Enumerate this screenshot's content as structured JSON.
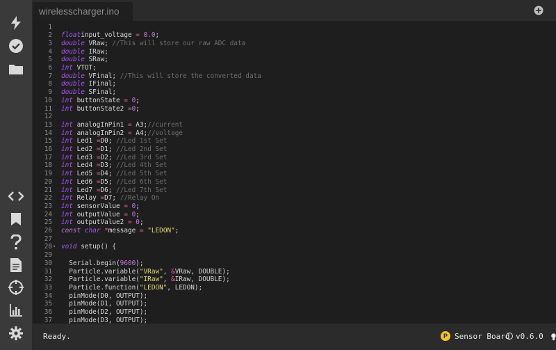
{
  "tab": {
    "title": "wirelesscharger.ino"
  },
  "sidebar": {
    "items": [
      {
        "icon": "flash-icon"
      },
      {
        "icon": "verify-check-icon"
      },
      {
        "icon": "folder-icon"
      },
      {
        "icon": "code-icon"
      },
      {
        "icon": "bookmark-icon"
      },
      {
        "icon": "help-icon"
      },
      {
        "icon": "document-icon"
      },
      {
        "icon": "target-icon"
      },
      {
        "icon": "chart-icon"
      },
      {
        "icon": "gear-icon"
      }
    ]
  },
  "editor": {
    "lines": [
      {
        "n": "1",
        "t": []
      },
      {
        "n": "2",
        "t": [
          [
            "ty",
            "float"
          ],
          [
            "",
            "input_voltage "
          ],
          [
            "op",
            "="
          ],
          [
            "",
            " "
          ],
          [
            "num",
            "0.0"
          ],
          [
            "",
            ";"
          ]
        ]
      },
      {
        "n": "3",
        "t": [
          [
            "ty",
            "double"
          ],
          [
            "",
            " VRaw; "
          ],
          [
            "cm",
            "//This will store our raw ADC data"
          ]
        ]
      },
      {
        "n": "4",
        "t": [
          [
            "ty",
            "double"
          ],
          [
            "",
            " IRaw;"
          ]
        ]
      },
      {
        "n": "5",
        "t": [
          [
            "ty",
            "double"
          ],
          [
            "",
            " SRaw;"
          ]
        ]
      },
      {
        "n": "6",
        "t": [
          [
            "ty",
            "int"
          ],
          [
            "",
            " VTOT;"
          ]
        ]
      },
      {
        "n": "7",
        "t": [
          [
            "ty",
            "double"
          ],
          [
            "",
            " VFinal; "
          ],
          [
            "cm",
            "//This will store the converted data"
          ]
        ]
      },
      {
        "n": "8",
        "t": [
          [
            "ty",
            "double"
          ],
          [
            "",
            " IFinal;"
          ]
        ]
      },
      {
        "n": "9",
        "t": [
          [
            "ty",
            "double"
          ],
          [
            "",
            " SFinal;"
          ]
        ]
      },
      {
        "n": "10",
        "t": [
          [
            "ty",
            "int"
          ],
          [
            "",
            " buttonState "
          ],
          [
            "op",
            "="
          ],
          [
            "",
            " "
          ],
          [
            "num",
            "0"
          ],
          [
            "",
            ";"
          ]
        ]
      },
      {
        "n": "11",
        "t": [
          [
            "ty",
            "int"
          ],
          [
            "",
            " buttonState2 "
          ],
          [
            "op",
            "="
          ],
          [
            "num",
            "0"
          ],
          [
            "",
            ";"
          ]
        ]
      },
      {
        "n": "12",
        "t": []
      },
      {
        "n": "13",
        "t": [
          [
            "ty",
            "int"
          ],
          [
            "",
            " analogInPin1 "
          ],
          [
            "op",
            "="
          ],
          [
            "",
            " A3;"
          ],
          [
            "cm",
            "//current"
          ]
        ]
      },
      {
        "n": "14",
        "t": [
          [
            "ty",
            "int"
          ],
          [
            "",
            " analogInPin2 "
          ],
          [
            "op",
            "="
          ],
          [
            "",
            " A4;"
          ],
          [
            "cm",
            "//voltage"
          ]
        ]
      },
      {
        "n": "15",
        "t": [
          [
            "ty",
            "int"
          ],
          [
            "",
            " Led1 "
          ],
          [
            "op",
            "="
          ],
          [
            "",
            "D0; "
          ],
          [
            "cm",
            "//Led 1st Set"
          ]
        ]
      },
      {
        "n": "16",
        "t": [
          [
            "ty",
            "int"
          ],
          [
            "",
            " Led2 "
          ],
          [
            "op",
            "="
          ],
          [
            "",
            "D1; "
          ],
          [
            "cm",
            "//Led 2nd Set"
          ]
        ]
      },
      {
        "n": "17",
        "t": [
          [
            "ty",
            "int"
          ],
          [
            "",
            " Led3 "
          ],
          [
            "op",
            "="
          ],
          [
            "",
            "D2; "
          ],
          [
            "cm",
            "//Led 3rd Set"
          ]
        ]
      },
      {
        "n": "18",
        "t": [
          [
            "ty",
            "int"
          ],
          [
            "",
            " Led4 "
          ],
          [
            "op",
            "="
          ],
          [
            "",
            "D3; "
          ],
          [
            "cm",
            "//Led 4th Set"
          ]
        ]
      },
      {
        "n": "19",
        "t": [
          [
            "ty",
            "int"
          ],
          [
            "",
            " Led5 "
          ],
          [
            "op",
            "="
          ],
          [
            "",
            "D4; "
          ],
          [
            "cm",
            "//Led 5th Set"
          ]
        ]
      },
      {
        "n": "20",
        "t": [
          [
            "ty",
            "int"
          ],
          [
            "",
            " Led6 "
          ],
          [
            "op",
            "="
          ],
          [
            "",
            "D5; "
          ],
          [
            "cm",
            "//Led 6th Set"
          ]
        ]
      },
      {
        "n": "21",
        "t": [
          [
            "ty",
            "int"
          ],
          [
            "",
            " Led7 "
          ],
          [
            "op",
            "="
          ],
          [
            "",
            "D6; "
          ],
          [
            "cm",
            "//Led 7th Set"
          ]
        ]
      },
      {
        "n": "22",
        "t": [
          [
            "ty",
            "int"
          ],
          [
            "",
            " Relay "
          ],
          [
            "op",
            "="
          ],
          [
            "",
            "D7; "
          ],
          [
            "cm",
            "//Relay On"
          ]
        ]
      },
      {
        "n": "23",
        "t": [
          [
            "ty",
            "int"
          ],
          [
            "",
            " sensorValue "
          ],
          [
            "op",
            "="
          ],
          [
            "",
            " "
          ],
          [
            "num",
            "0"
          ],
          [
            "",
            ";"
          ]
        ]
      },
      {
        "n": "24",
        "t": [
          [
            "ty",
            "int"
          ],
          [
            "",
            " outputValue "
          ],
          [
            "op",
            "="
          ],
          [
            "",
            " "
          ],
          [
            "num",
            "0"
          ],
          [
            "",
            ";"
          ]
        ]
      },
      {
        "n": "25",
        "t": [
          [
            "ty",
            "int"
          ],
          [
            "",
            " outputValue2 "
          ],
          [
            "op",
            "="
          ],
          [
            "",
            " "
          ],
          [
            "num",
            "0"
          ],
          [
            "",
            ";"
          ]
        ]
      },
      {
        "n": "26",
        "t": [
          [
            "kw",
            "const"
          ],
          [
            "",
            " "
          ],
          [
            "ty",
            "char"
          ],
          [
            "",
            " "
          ],
          [
            "op",
            "*"
          ],
          [
            "",
            "message "
          ],
          [
            "op",
            "="
          ],
          [
            "",
            " "
          ],
          [
            "str",
            "\"LEDON\""
          ],
          [
            "",
            ";"
          ]
        ]
      },
      {
        "n": "27",
        "t": []
      },
      {
        "n": "28",
        "fold": true,
        "t": [
          [
            "ty",
            "void"
          ],
          [
            "",
            " setup() {"
          ]
        ]
      },
      {
        "n": "29",
        "t": []
      },
      {
        "n": "30",
        "t": [
          [
            "",
            "  Serial.begin("
          ],
          [
            "num",
            "9600"
          ],
          [
            "",
            ");"
          ]
        ]
      },
      {
        "n": "31",
        "t": [
          [
            "",
            "  Particle.variable("
          ],
          [
            "str",
            "\"VRaw\""
          ],
          [
            "",
            ", "
          ],
          [
            "op",
            "&"
          ],
          [
            "",
            "VRaw, DOUBLE);"
          ]
        ]
      },
      {
        "n": "32",
        "t": [
          [
            "",
            "  Particle.variable("
          ],
          [
            "str",
            "\"IRaw\""
          ],
          [
            "",
            ", "
          ],
          [
            "op",
            "&"
          ],
          [
            "",
            "IRaw, DOUBLE);"
          ]
        ]
      },
      {
        "n": "33",
        "t": [
          [
            "",
            "  Particle.function("
          ],
          [
            "str",
            "\"LEDON\""
          ],
          [
            "",
            ", LEDON);"
          ]
        ]
      },
      {
        "n": "34",
        "t": [
          [
            "",
            "  pinMode(D0, OUTPUT);"
          ]
        ]
      },
      {
        "n": "35",
        "t": [
          [
            "",
            "  pinMode(D1, OUTPUT);"
          ]
        ]
      },
      {
        "n": "36",
        "t": [
          [
            "",
            "  pinMode(D2, OUTPUT);"
          ]
        ]
      },
      {
        "n": "37",
        "t": [
          [
            "",
            "  pinMode(D3, OUTPUT);"
          ]
        ]
      }
    ]
  },
  "status": {
    "text": "Ready.",
    "device_badge": "P",
    "device_name": "Sensor Board",
    "version": "v0.6.0"
  },
  "colors": {
    "keyword": "#c678dd",
    "string": "#e6db74",
    "comment": "#6f6f6f",
    "operator": "#f25ca2",
    "badge": "#f5c518"
  }
}
